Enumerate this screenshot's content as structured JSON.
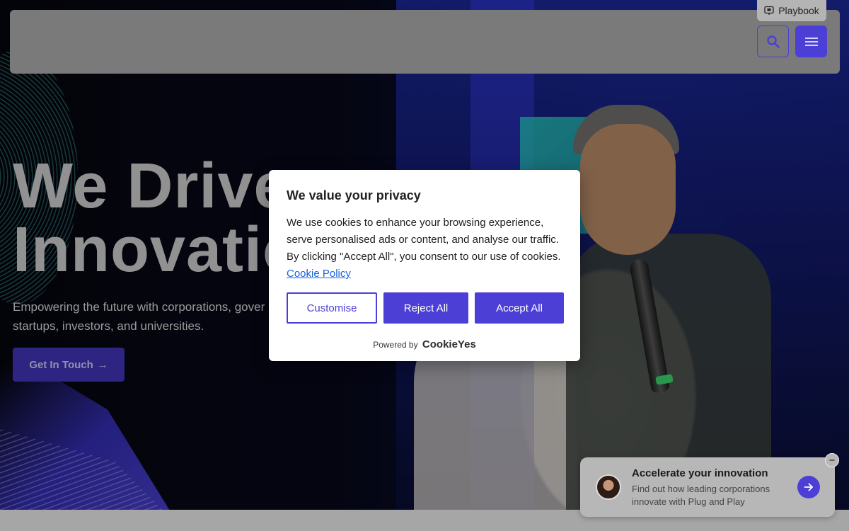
{
  "top_tab": {
    "label": "Playbook",
    "icon": "presentation-icon"
  },
  "navbar": {
    "search_icon": "search-icon",
    "menu_icon": "hamburger-menu-icon"
  },
  "hero": {
    "title_line1": "We Drive",
    "title_line2": "Innovatio",
    "subtitle_line1": "Empowering the future with corporations, gover",
    "subtitle_line2": "startups, investors, and universities.",
    "cta_label": "Get In Touch",
    "cta_arrow": "→"
  },
  "cookie_banner": {
    "title": "We value your privacy",
    "body": "We use cookies to enhance your browsing experience, serve personalised ads or content, and analyse our traffic. By clicking \"Accept All\", you consent to our use of cookies.",
    "policy_link": "Cookie Policy",
    "customise_label": "Customise",
    "reject_label": "Reject All",
    "accept_label": "Accept All",
    "powered_by": "Powered by",
    "brand": "CookieYes"
  },
  "chat_widget": {
    "title": "Accelerate your innovation",
    "subtitle": "Find out how leading corporations innovate with Plug and Play",
    "close_symbol": "−"
  },
  "colors": {
    "accent": "#4c3fd6",
    "link": "#1863dc"
  }
}
